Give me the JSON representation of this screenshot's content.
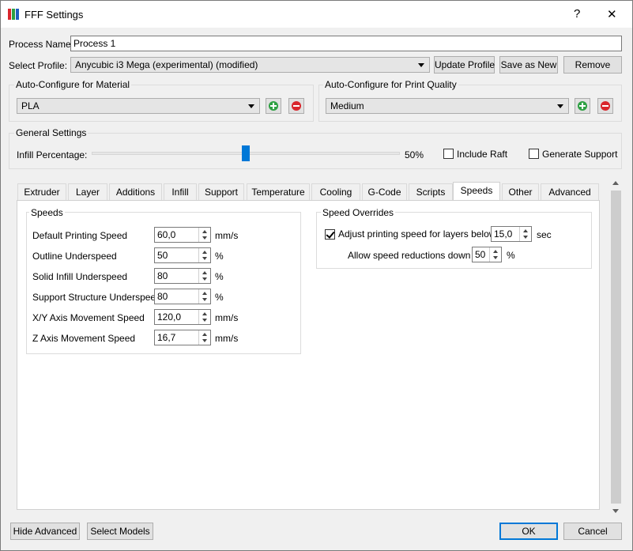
{
  "window": {
    "title": "FFF Settings",
    "help": "?",
    "close": "✕"
  },
  "process": {
    "label": "Process Name:",
    "value": "Process 1"
  },
  "profile": {
    "label": "Select Profile:",
    "selected": "Anycubic i3 Mega (experimental) (modified)",
    "update_label": "Update Profile",
    "save_new_label": "Save as New",
    "remove_label": "Remove"
  },
  "material": {
    "title": "Auto-Configure for Material",
    "selected": "PLA"
  },
  "quality": {
    "title": "Auto-Configure for Print Quality",
    "selected": "Medium"
  },
  "general": {
    "title": "General Settings",
    "infill_label": "Infill Percentage:",
    "infill_value": "50%",
    "include_raft": "Include Raft",
    "generate_support": "Generate Support"
  },
  "tabs": [
    {
      "label": "Extruder"
    },
    {
      "label": "Layer"
    },
    {
      "label": "Additions"
    },
    {
      "label": "Infill"
    },
    {
      "label": "Support"
    },
    {
      "label": "Temperature"
    },
    {
      "label": "Cooling"
    },
    {
      "label": "G-Code"
    },
    {
      "label": "Scripts"
    },
    {
      "label": "Speeds"
    },
    {
      "label": "Other"
    },
    {
      "label": "Advanced"
    }
  ],
  "speeds": {
    "title": "Speeds",
    "rows": [
      {
        "label": "Default Printing Speed",
        "value": "60,0",
        "unit": "mm/s"
      },
      {
        "label": "Outline Underspeed",
        "value": "50",
        "unit": "%"
      },
      {
        "label": "Solid Infill Underspeed",
        "value": "80",
        "unit": "%"
      },
      {
        "label": "Support Structure Underspeed",
        "value": "80",
        "unit": "%"
      },
      {
        "label": "X/Y Axis Movement Speed",
        "value": "120,0",
        "unit": "mm/s"
      },
      {
        "label": "Z Axis Movement Speed",
        "value": "16,7",
        "unit": "mm/s"
      }
    ]
  },
  "overrides": {
    "title": "Speed Overrides",
    "adjust_label": "Adjust printing speed for layers below",
    "adjust_value": "15,0",
    "adjust_unit": "sec",
    "reduce_label": "Allow speed reductions down to",
    "reduce_value": "50",
    "reduce_unit": "%"
  },
  "footer": {
    "hide_advanced": "Hide Advanced",
    "select_models": "Select Models",
    "ok": "OK",
    "cancel": "Cancel"
  },
  "colors": {
    "accent": "#0078d7",
    "add": "#2ea043",
    "remove": "#d9262c"
  },
  "state": {
    "infill_percent": 50,
    "include_raft": false,
    "generate_support": false,
    "adjust_speed": true,
    "active_tab": "Speeds"
  }
}
